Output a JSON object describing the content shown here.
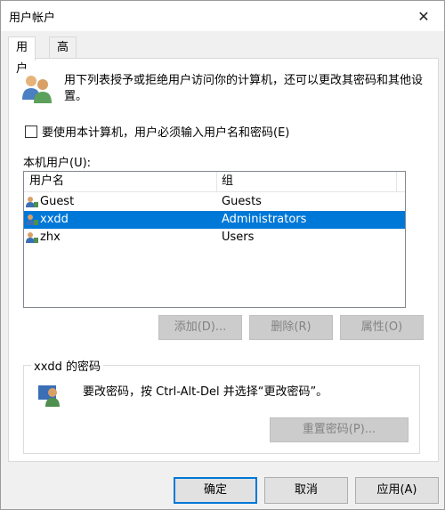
{
  "window": {
    "title": "用户帐户",
    "close_glyph": "✕"
  },
  "tabs": [
    {
      "label": "用户",
      "active": true
    },
    {
      "label": "高级",
      "active": false
    }
  ],
  "description": "用下列表授予或拒绝用户访问你的计算机，还可以更改其密码和其他设置。",
  "require_login_checkbox": {
    "label": "要使用本计算机，用户必须输入用户名和密码(E)",
    "checked": false
  },
  "users_list": {
    "label": "本机用户(U):",
    "columns": [
      "用户名",
      "组"
    ],
    "rows": [
      {
        "name": "Guest",
        "group": "Guests",
        "selected": false
      },
      {
        "name": "xxdd",
        "group": "Administrators",
        "selected": true
      },
      {
        "name": "zhx",
        "group": "Users",
        "selected": false
      }
    ]
  },
  "list_buttons": {
    "add": "添加(D)...",
    "remove": "删除(R)",
    "properties": "属性(O)"
  },
  "password_group": {
    "title": "xxdd 的密码",
    "text": "要改密码，按 Ctrl-Alt-Del 并选择“更改密码”。",
    "reset_button": "重置密码(P)..."
  },
  "footer": {
    "ok": "确定",
    "cancel": "取消",
    "apply": "应用(A)"
  },
  "colors": {
    "selection": "#0078d7",
    "disabled_text": "#838383"
  }
}
